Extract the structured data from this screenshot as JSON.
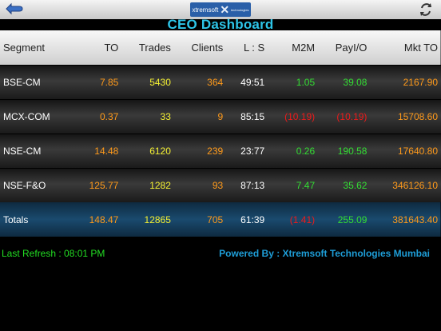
{
  "header": {
    "logo_text": "xtremsoft",
    "logo_sub": "technologies",
    "title": "CEO Dashboard",
    "back_icon": "back-arrow-icon",
    "refresh_icon": "refresh-icon"
  },
  "table": {
    "columns": [
      "Segment",
      "TO",
      "Trades",
      "Clients",
      "L : S",
      "M2M",
      "PayI/O",
      "Mkt TO"
    ],
    "rows": [
      {
        "segment": "BSE-CM",
        "to": "7.85",
        "trades": "5430",
        "clients": "364",
        "ls": "49:51",
        "m2m": "1.05",
        "payio": "39.08",
        "mktto": "2167.90"
      },
      {
        "segment": "MCX-COM",
        "to": "0.37",
        "trades": "33",
        "clients": "9",
        "ls": "85:15",
        "m2m": "(10.19)",
        "payio": "(10.19)",
        "mktto": "15708.60"
      },
      {
        "segment": "NSE-CM",
        "to": "14.48",
        "trades": "6120",
        "clients": "239",
        "ls": "23:77",
        "m2m": "0.26",
        "payio": "190.58",
        "mktto": "17640.80"
      },
      {
        "segment": "NSE-F&O",
        "to": "125.77",
        "trades": "1282",
        "clients": "93",
        "ls": "87:13",
        "m2m": "7.47",
        "payio": "35.62",
        "mktto": "346126.10"
      }
    ],
    "totals": {
      "segment": "Totals",
      "to": "148.47",
      "trades": "12865",
      "clients": "705",
      "ls": "61:39",
      "m2m": "(1.41)",
      "payio": "255.09",
      "mktto": "381643.40"
    }
  },
  "footer": {
    "last_refresh": "Last Refresh : 08:01 PM",
    "powered_by": "Powered By : Xtremsoft Technologies Mumbai"
  },
  "colors": {
    "title": "#2dc5e8",
    "positive": "#33dd33",
    "negative": "#ee1a1a",
    "to": "#ff9a1a",
    "trades": "#f4f032"
  }
}
